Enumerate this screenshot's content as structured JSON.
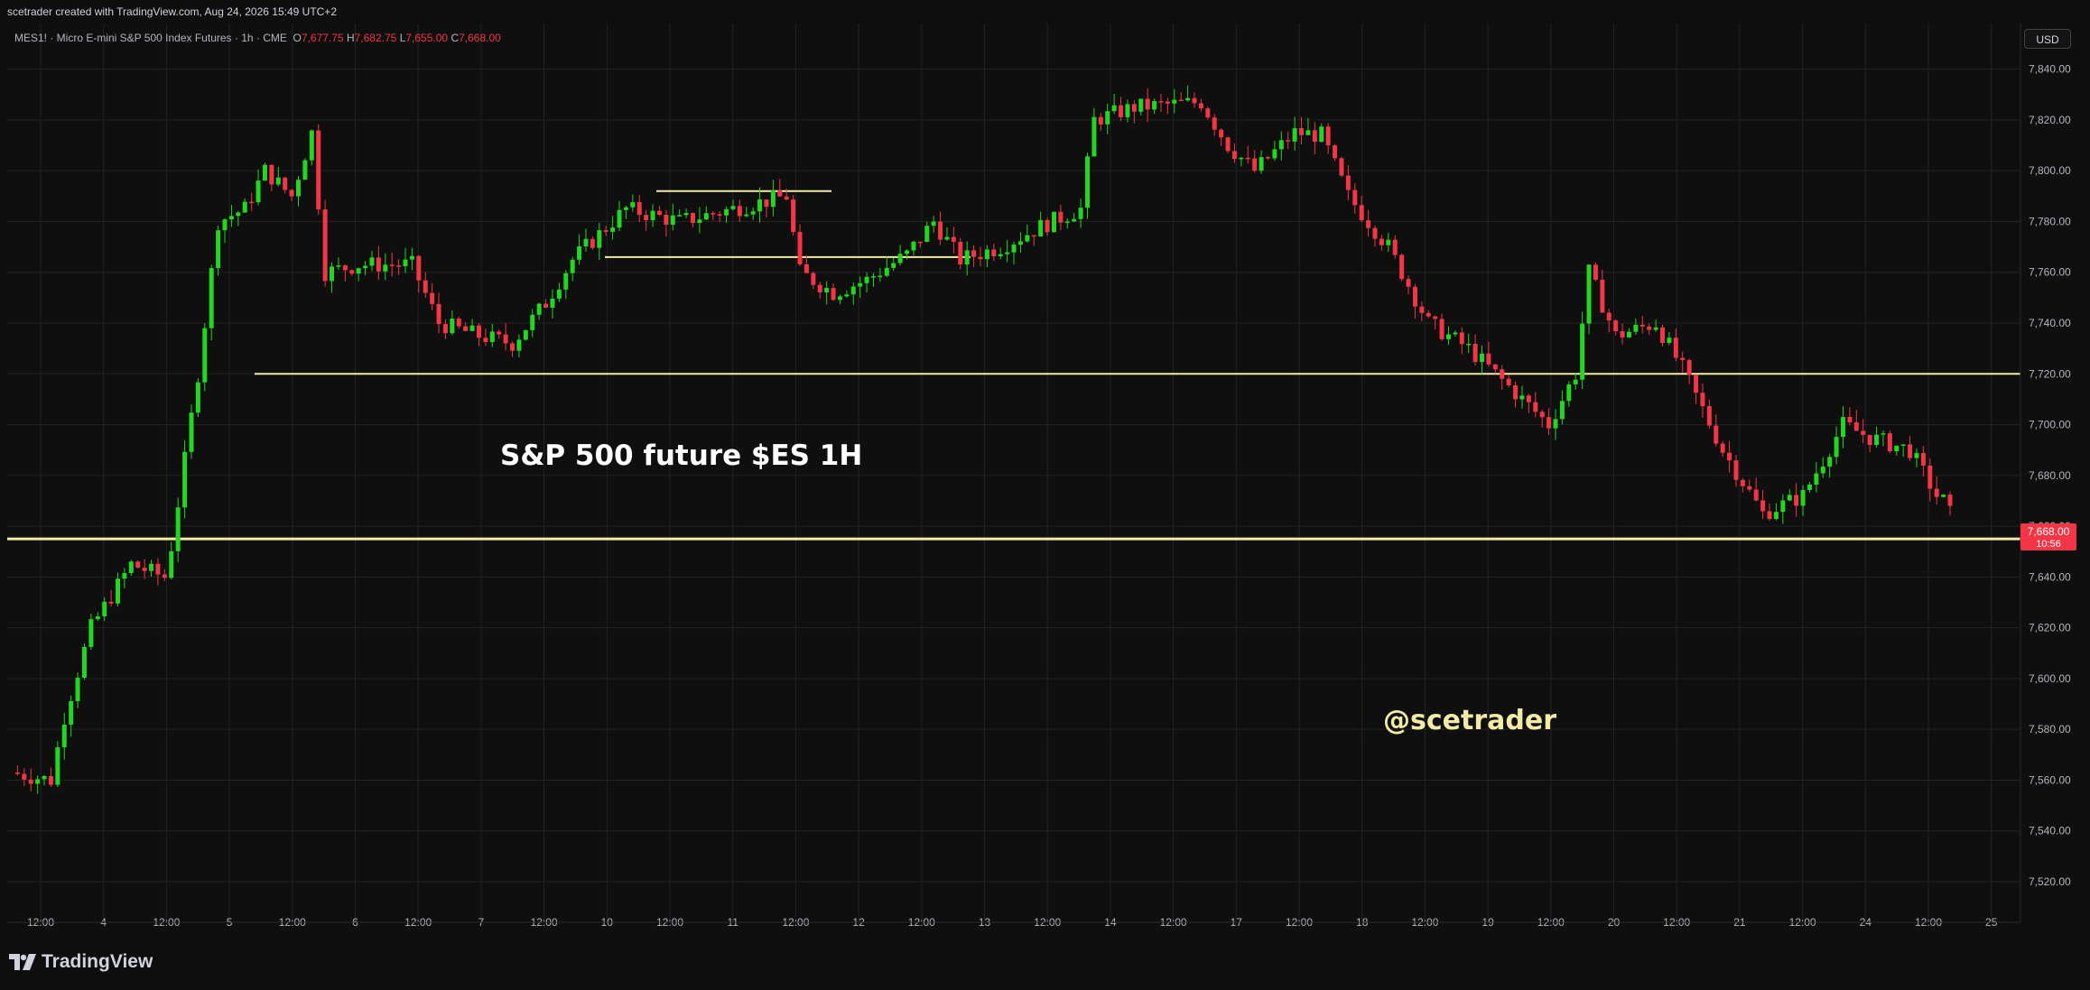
{
  "header": {
    "credit": "scetrader created with TradingView.com, Aug 24, 2026 15:49 UTC+2"
  },
  "legend": {
    "symbol": "MES1! · Micro E-mini S&P 500 Index Futures · 1h · CME",
    "o_label": "O",
    "o_value": "7,677.75",
    "h_label": "H",
    "h_value": "7,682.75",
    "l_label": "L",
    "l_value": "7,655.00",
    "c_label": "C",
    "c_value": "7,668.00"
  },
  "currency_button": "USD",
  "price_tag": {
    "value": "7,668.00",
    "countdown": "10:56"
  },
  "colors": {
    "up": "#22d622",
    "down": "#f23645",
    "level": "#f2eba6",
    "grid": "#232323",
    "background": "#0f0f0f",
    "axis_text": "#b2b5be",
    "tag": "#f23645"
  },
  "icons": {
    "brand_logo": "tradingview-logo-icon"
  },
  "footer": {
    "brand": "TradingView"
  },
  "chart_data": {
    "type": "candlestick",
    "title": "S&P 500 future $ES 1H",
    "watermark": "@scetrader",
    "y_ticks": [
      "7,520.00",
      "7,540.00",
      "7,560.00",
      "7,580.00",
      "7,600.00",
      "7,620.00",
      "7,640.00",
      "7,660.00",
      "7,680.00",
      "7,700.00",
      "7,720.00",
      "7,740.00",
      "7,760.00",
      "7,780.00",
      "7,800.00",
      "7,820.00",
      "7,840.00"
    ],
    "y_tick_values": [
      7520,
      7540,
      7560,
      7580,
      7600,
      7620,
      7640,
      7660,
      7680,
      7700,
      7720,
      7740,
      7760,
      7780,
      7800,
      7820,
      7840
    ],
    "ylim": [
      7504,
      7858
    ],
    "x_ticks": [
      "12:00",
      "4",
      "12:00",
      "5",
      "12:00",
      "6",
      "12:00",
      "7",
      "12:00",
      "10",
      "12:00",
      "11",
      "12:00",
      "12",
      "12:00",
      "13",
      "12:00",
      "14",
      "12:00",
      "17",
      "12:00",
      "18",
      "12:00",
      "19",
      "12:00",
      "20",
      "12:00",
      "21",
      "12:00",
      "24",
      "12:00",
      "25"
    ],
    "last_price": 7668.0,
    "horizontal_levels": [
      7720,
      7655,
      7766,
      7792
    ],
    "grid": true,
    "path_keyframes": [
      [
        0,
        7563
      ],
      [
        6,
        7560
      ],
      [
        8,
        7585
      ],
      [
        12,
        7620
      ],
      [
        18,
        7645
      ],
      [
        23,
        7640
      ],
      [
        24,
        7652
      ],
      [
        28,
        7720
      ],
      [
        31,
        7780
      ],
      [
        35,
        7785
      ],
      [
        38,
        7800
      ],
      [
        42,
        7790
      ],
      [
        45,
        7815
      ],
      [
        47,
        7760
      ],
      [
        52,
        7763
      ],
      [
        60,
        7763
      ],
      [
        64,
        7740
      ],
      [
        70,
        7735
      ],
      [
        75,
        7732
      ],
      [
        80,
        7748
      ],
      [
        84,
        7765
      ],
      [
        92,
        7785
      ],
      [
        100,
        7780
      ],
      [
        108,
        7785
      ],
      [
        116,
        7790
      ],
      [
        118,
        7760
      ],
      [
        123,
        7752
      ],
      [
        128,
        7757
      ],
      [
        134,
        7767
      ],
      [
        138,
        7780
      ],
      [
        142,
        7765
      ],
      [
        148,
        7770
      ],
      [
        154,
        7778
      ],
      [
        160,
        7785
      ],
      [
        162,
        7820
      ],
      [
        168,
        7825
      ],
      [
        178,
        7827
      ],
      [
        182,
        7810
      ],
      [
        186,
        7800
      ],
      [
        192,
        7815
      ],
      [
        196,
        7814
      ],
      [
        200,
        7790
      ],
      [
        206,
        7770
      ],
      [
        212,
        7740
      ],
      [
        218,
        7730
      ],
      [
        224,
        7715
      ],
      [
        230,
        7700
      ],
      [
        234,
        7720
      ],
      [
        236,
        7760
      ],
      [
        240,
        7735
      ],
      [
        246,
        7740
      ],
      [
        250,
        7722
      ],
      [
        256,
        7690
      ],
      [
        262,
        7665
      ],
      [
        268,
        7672
      ],
      [
        274,
        7700
      ],
      [
        278,
        7695
      ],
      [
        284,
        7690
      ],
      [
        288,
        7672
      ],
      [
        290,
        7668
      ]
    ]
  }
}
